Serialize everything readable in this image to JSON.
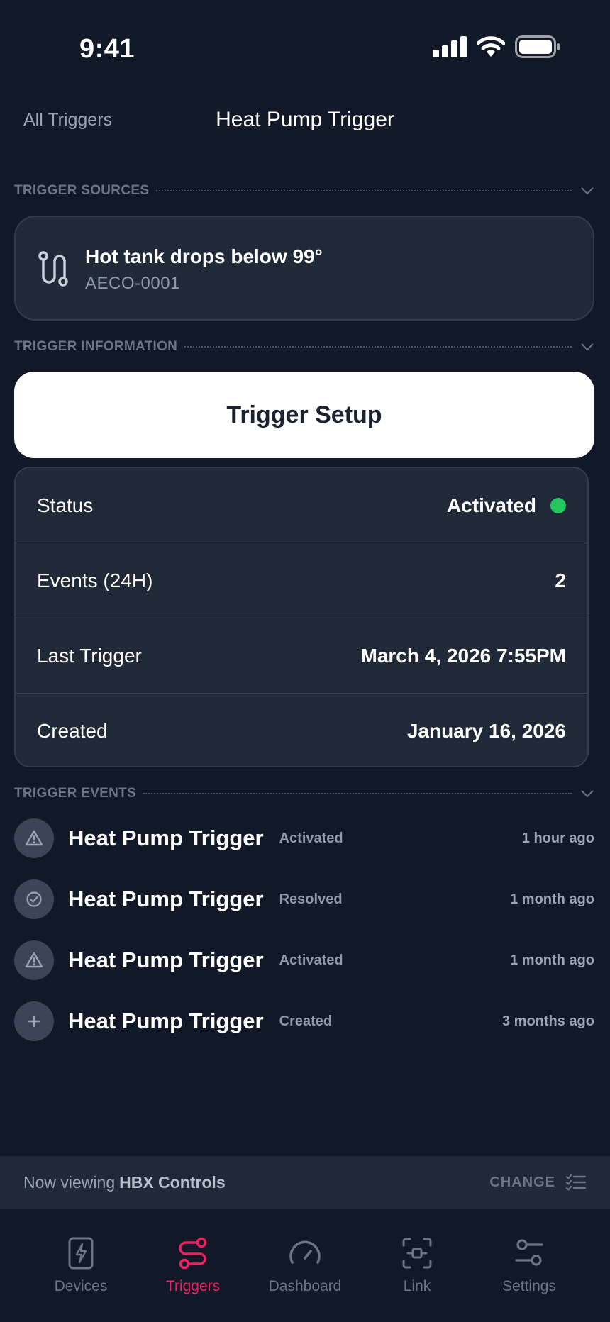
{
  "status_bar": {
    "time": "9:41"
  },
  "nav": {
    "back_label": "All Triggers",
    "title": "Heat Pump Trigger"
  },
  "sections": {
    "sources": "TRIGGER SOURCES",
    "information": "TRIGGER INFORMATION",
    "events": "TRIGGER EVENTS"
  },
  "source": {
    "title": "Hot tank drops below 99°",
    "subtitle": "AECO-0001",
    "icon": "route-icon"
  },
  "setup_button": "Trigger Setup",
  "info": {
    "status_label": "Status",
    "status_value": "Activated",
    "status_color": "#22c55e",
    "events_label": "Events (24H)",
    "events_value": "2",
    "last_label": "Last Trigger",
    "last_value": "March 4, 2026 7:55PM",
    "created_label": "Created",
    "created_value": "January 16, 2026"
  },
  "events": [
    {
      "title": "Heat Pump Trigger",
      "state": "Activated",
      "time": "1 hour ago",
      "icon": "warning-icon"
    },
    {
      "title": "Heat Pump Trigger",
      "state": "Resolved",
      "time": "1 month ago",
      "icon": "check-circle-icon"
    },
    {
      "title": "Heat Pump Trigger",
      "state": "Activated",
      "time": "1 month ago",
      "icon": "warning-icon"
    },
    {
      "title": "Heat Pump Trigger",
      "state": "Created",
      "time": "3 months ago",
      "icon": "plus-icon"
    }
  ],
  "viewing": {
    "prefix": "Now viewing",
    "org": "HBX Controls",
    "change": "CHANGE"
  },
  "tabs": [
    {
      "label": "Devices",
      "icon": "device-bolt-icon"
    },
    {
      "label": "Triggers",
      "icon": "route-icon",
      "active": true
    },
    {
      "label": "Dashboard",
      "icon": "gauge-icon"
    },
    {
      "label": "Link",
      "icon": "scan-link-icon"
    },
    {
      "label": "Settings",
      "icon": "sliders-icon"
    }
  ],
  "colors": {
    "background": "#111827",
    "card": "#1f2937",
    "accent": "#ef1f61"
  }
}
